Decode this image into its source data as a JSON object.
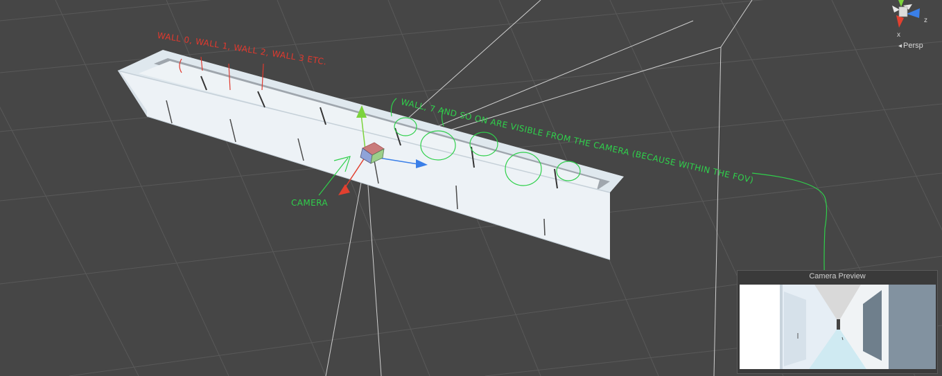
{
  "annotations": {
    "walls_note": "WALL 0, WALL 1, WALL 2, WALL 3 ETC.",
    "visible_note": "WALL, 7 AND SO ON ARE VISIBLE FROM THE CAMERA (BECAUSE WITHIN THE FOV)",
    "camera_label": "CAMERA"
  },
  "scene_gizmo": {
    "projection_label": "Persp",
    "axes": {
      "x": "x",
      "z": "z"
    }
  },
  "camera_preview": {
    "title": "Camera Preview"
  },
  "colors": {
    "background": "#464646",
    "grid": "#5a5a5a",
    "frustum": "#cfcfcf",
    "annotation_red": "#e0392e",
    "annotation_green": "#2fd04b",
    "axis_x": "#e2402f",
    "axis_y": "#7cd33d",
    "axis_z": "#3a7fe8"
  }
}
